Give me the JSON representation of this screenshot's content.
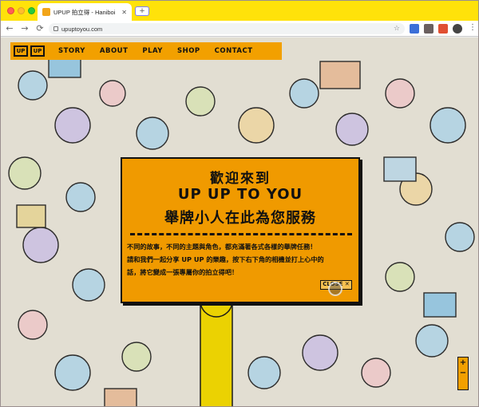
{
  "browser": {
    "tab_title": "UPUP 拍立得 - Haniboi",
    "tab_close": "✕",
    "new_tab": "+",
    "url": "upuptoyou.com",
    "nav": {
      "back": "←",
      "forward": "→",
      "reload": "⟳"
    },
    "bookmark_star": "☆",
    "menu": "⋮"
  },
  "site": {
    "logo": [
      "UP",
      "UP"
    ],
    "nav_links": [
      "STORY",
      "ABOUT",
      "PLAY",
      "SHOP",
      "CONTACT"
    ]
  },
  "modal": {
    "heading_1": "歡迎來到",
    "heading_2": "UP UP TO YOU",
    "heading_3": "舉牌小人在此為您服務",
    "body_lines": [
      "不同的故事，不同的主題與角色，都充滿著各式各樣的舉牌任務！",
      "請和我們一起分享 UP UP 的樂趣，按下右下角的相機並打上心中的",
      "話，將它變成一張專屬你的拍立得吧！"
    ],
    "close_label": "CLOSE ✕"
  },
  "zoom": {
    "plus": "+",
    "minus": "−"
  },
  "colors": {
    "brand_yellow": "#ffe20a",
    "brand_orange": "#f09a00",
    "ink": "#111111"
  }
}
